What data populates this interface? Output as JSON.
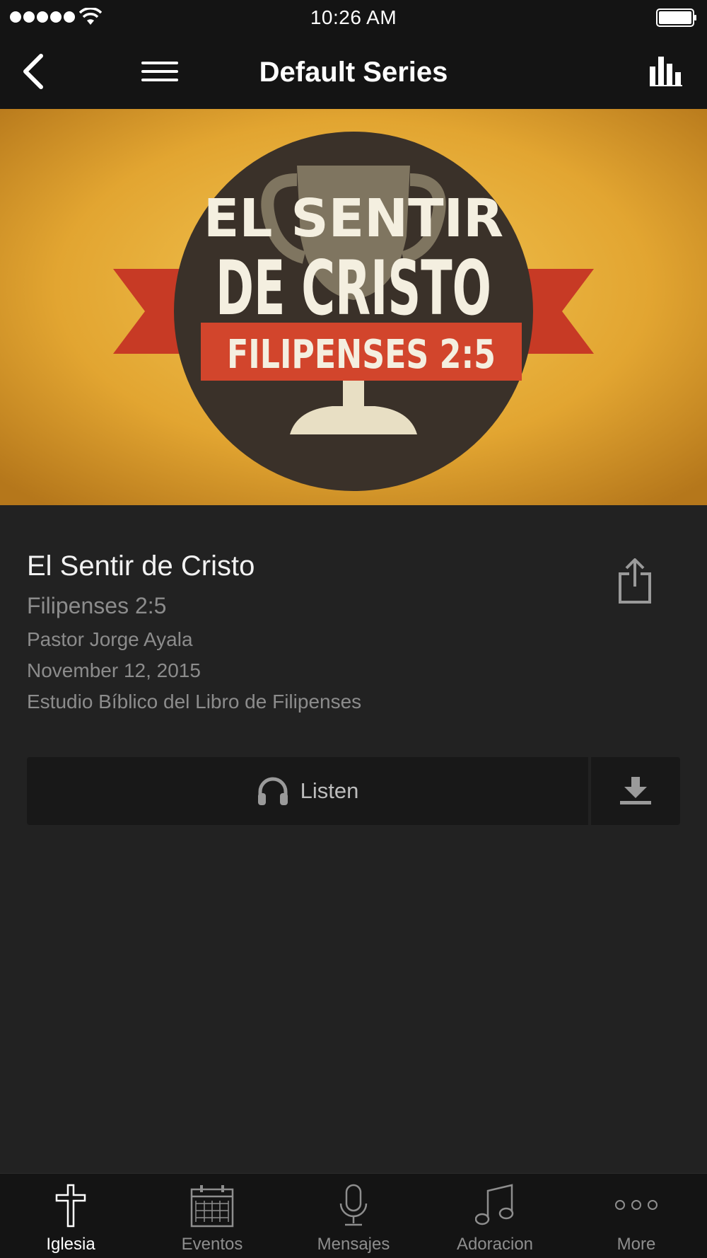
{
  "status_bar": {
    "time": "10:26 AM"
  },
  "nav": {
    "title": "Default Series",
    "icons": [
      "back-chevron-icon",
      "hamburger-menu-icon",
      "bar-chart-icon"
    ]
  },
  "hero": {
    "line1": "EL SENTIR",
    "line2": "DE CRISTO",
    "banner": "FILIPENSES 2:5"
  },
  "sermon": {
    "title": "El Sentir de Cristo",
    "passage": "Filipenses 2:5",
    "speaker": "Pastor Jorge Ayala",
    "date": "November 12, 2015",
    "series": "Estudio Bíblico del Libro de Filipenses"
  },
  "actions": {
    "listen_label": "Listen",
    "listen_icon": "headphones-icon",
    "download_icon": "download-icon",
    "share_icon": "share-icon"
  },
  "tabs": [
    {
      "label": "Iglesia",
      "icon": "cross-icon",
      "active": true
    },
    {
      "label": "Eventos",
      "icon": "calendar-icon",
      "active": false
    },
    {
      "label": "Mensajes",
      "icon": "microphone-icon",
      "active": false
    },
    {
      "label": "Adoracion",
      "icon": "music-note-icon",
      "active": false
    },
    {
      "label": "More",
      "icon": "more-dots-icon",
      "active": false
    }
  ],
  "colors": {
    "background": "#222222",
    "bar": "#141414",
    "hero_gold": "#e0a22e",
    "hero_red": "#d2452c",
    "hero_circle": "#3a3129"
  }
}
